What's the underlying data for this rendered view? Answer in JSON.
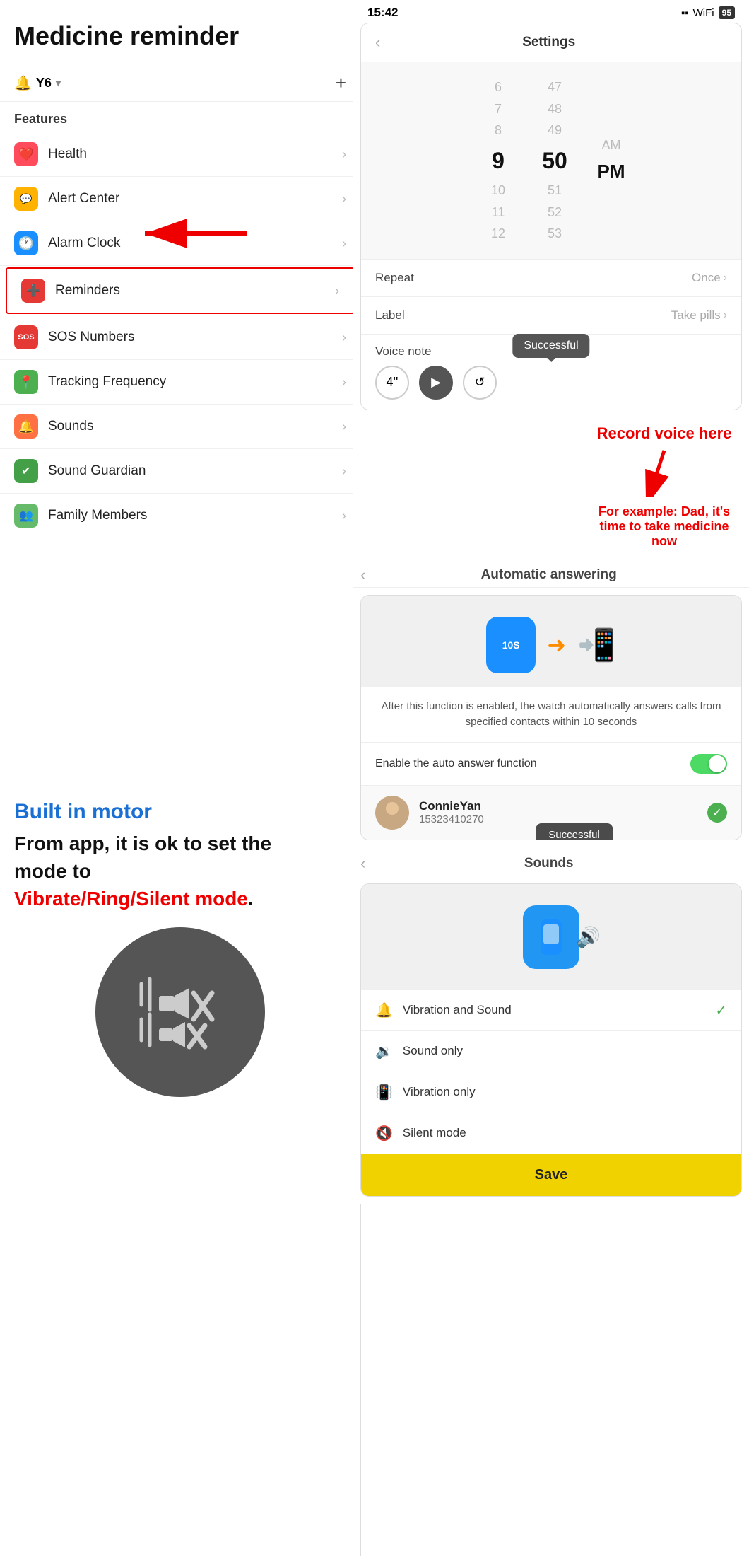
{
  "page": {
    "title": "Medicine reminder"
  },
  "app_header": {
    "bell_icon": "🔔",
    "device_name": "Y6",
    "chevron": "▾",
    "plus": "+"
  },
  "features": {
    "label": "Features",
    "items": [
      {
        "id": "health",
        "icon": "❤️",
        "icon_class": "icon-health",
        "label": "Health"
      },
      {
        "id": "alert",
        "icon": "💬",
        "icon_class": "icon-alert",
        "label": "Alert Center"
      },
      {
        "id": "alarm",
        "icon": "🕐",
        "icon_class": "icon-alarm",
        "label": "Alarm Clock"
      },
      {
        "id": "reminders",
        "icon": "➕",
        "icon_class": "icon-reminder",
        "label": "Reminders",
        "highlighted": true
      },
      {
        "id": "sos",
        "icon": "SOS",
        "icon_class": "icon-sos",
        "label": "SOS Numbers"
      },
      {
        "id": "tracking",
        "icon": "📍",
        "icon_class": "icon-tracking",
        "label": "Tracking Frequency"
      },
      {
        "id": "sounds",
        "icon": "🔔",
        "icon_class": "icon-sounds",
        "label": "Sounds"
      },
      {
        "id": "guardian",
        "icon": "🛡️",
        "icon_class": "icon-guardian",
        "label": "Sound Guardian"
      },
      {
        "id": "family",
        "icon": "👥",
        "icon_class": "icon-family",
        "label": "Family Members"
      }
    ]
  },
  "settings_screen": {
    "title": "Settings",
    "time_picker": {
      "hours": [
        "6",
        "7",
        "8",
        "9",
        "10",
        "11",
        "12"
      ],
      "minutes": [
        "47",
        "48",
        "49",
        "50",
        "51",
        "52",
        "53"
      ],
      "selected_hour": "9",
      "selected_minute": "50",
      "ampm": [
        "AM",
        "PM"
      ],
      "selected_ampm": "PM"
    },
    "rows": [
      {
        "label": "Repeat",
        "value": "Once"
      },
      {
        "label": "Label",
        "value": "Take pills"
      },
      {
        "label": "Voice note",
        "value": ""
      }
    ],
    "voice_duration": "4''",
    "tooltip": "Successful"
  },
  "annotations": {
    "record_voice": "Record voice here",
    "example_text": "For example: Dad, it's time to take medicine now"
  },
  "auto_answer_screen": {
    "back_label": "‹",
    "title": "Automatic answering",
    "description": "After this function is enabled, the watch automatically answers calls from specified contacts within 10 seconds",
    "toggle_label": "Enable the auto answer function",
    "contact_name": "ConnieYan",
    "contact_number": "15323410270",
    "tooltip": "Successful"
  },
  "left_bottom": {
    "built_motor": "Built in motor",
    "mode_line1": "From app, it is ok to set the",
    "mode_line2": "mode to",
    "modes": "Vibrate/Ring/Silent mode."
  },
  "sounds_screen": {
    "back_label": "‹",
    "title": "Sounds",
    "options": [
      {
        "id": "vibration-sound",
        "label": "Vibration and Sound",
        "checked": true
      },
      {
        "id": "sound-only",
        "label": "Sound only",
        "checked": false
      },
      {
        "id": "vibration-only",
        "label": "Vibration only",
        "checked": false
      },
      {
        "id": "silent-mode",
        "label": "Silent mode",
        "checked": false
      }
    ],
    "save_label": "Save"
  },
  "status_bar": {
    "time": "15:42",
    "signal": "▪▪",
    "wifi": "WiFi",
    "battery": "95"
  }
}
